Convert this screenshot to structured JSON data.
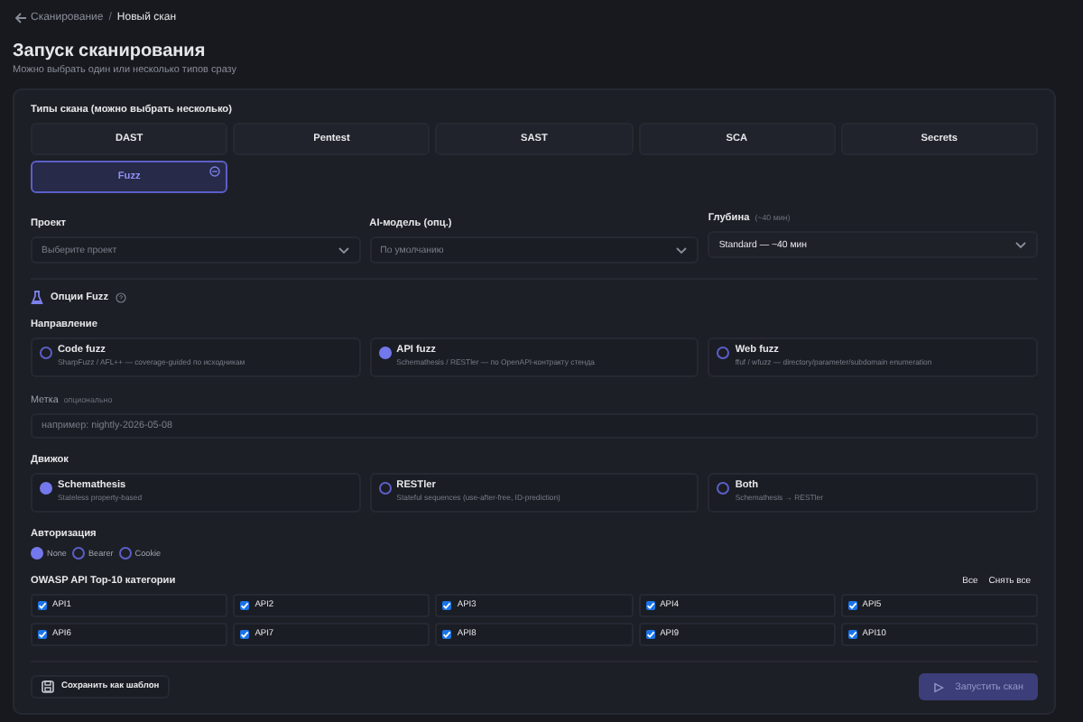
{
  "breadcrumb": {
    "back": "Сканирование",
    "current": "Новый скан",
    "separator": "/"
  },
  "title": "Запуск сканирования",
  "subtitle": "Можно выбрать один или несколько типов сразу",
  "scan_types": {
    "label": "Типы скана (можно выбрать несколько)",
    "items": [
      {
        "label": "DAST",
        "selected": false
      },
      {
        "label": "Pentest",
        "selected": false
      },
      {
        "label": "SAST",
        "selected": false
      },
      {
        "label": "SCA",
        "selected": false
      },
      {
        "label": "Secrets",
        "selected": false
      },
      {
        "label": "Fuzz",
        "selected": true
      }
    ]
  },
  "project": {
    "label": "Проект",
    "placeholder": "Выберите проект"
  },
  "ai_model": {
    "label": "AI-модель (опц.)",
    "placeholder": "По умолчанию"
  },
  "depth": {
    "label": "Глубина",
    "hint": "(~40 мин)",
    "value": "Standard — ~40 мин"
  },
  "fuzz_options": {
    "title": "Опции Fuzz"
  },
  "direction": {
    "label": "Направление",
    "options": [
      {
        "title": "Code fuzz",
        "description": "SharpFuzz / AFL++ — coverage-guided по исходникам",
        "selected": false
      },
      {
        "title": "API fuzz",
        "description": "Schemathesis / RESTler — по OpenAPI-контракту стенда",
        "selected": true
      },
      {
        "title": "Web fuzz",
        "description": "ffuf / wfuzz — directory/parameter/subdomain enumeration",
        "selected": false
      }
    ]
  },
  "tag": {
    "label": "Метка",
    "hint": "опционально",
    "placeholder": "например: nightly-2026-05-08"
  },
  "engine": {
    "label": "Движок",
    "options": [
      {
        "title": "Schemathesis",
        "description": "Stateless property-based",
        "selected": true
      },
      {
        "title": "RESTler",
        "description": "Stateful sequences (use-after-free, ID-prediction)",
        "selected": false
      },
      {
        "title": "Both",
        "description": "Schemathesis → RESTler",
        "selected": false
      }
    ]
  },
  "auth": {
    "label": "Авторизация",
    "options": [
      {
        "label": "None",
        "selected": true
      },
      {
        "label": "Bearer",
        "selected": false
      },
      {
        "label": "Cookie",
        "selected": false
      }
    ]
  },
  "owasp": {
    "label": "OWASP API Top-10 категории",
    "select_all": "Все",
    "clear_all": "Снять все",
    "items": [
      {
        "label": "API1",
        "checked": true
      },
      {
        "label": "API2",
        "checked": true
      },
      {
        "label": "API3",
        "checked": true
      },
      {
        "label": "API4",
        "checked": true
      },
      {
        "label": "API5",
        "checked": true
      },
      {
        "label": "API6",
        "checked": true
      },
      {
        "label": "API7",
        "checked": true
      },
      {
        "label": "API8",
        "checked": true
      },
      {
        "label": "API9",
        "checked": true
      },
      {
        "label": "API10",
        "checked": true
      }
    ]
  },
  "save_template": "Сохранить как шаблон",
  "run_button": {
    "label": "Запустить скан",
    "disabled": true
  }
}
